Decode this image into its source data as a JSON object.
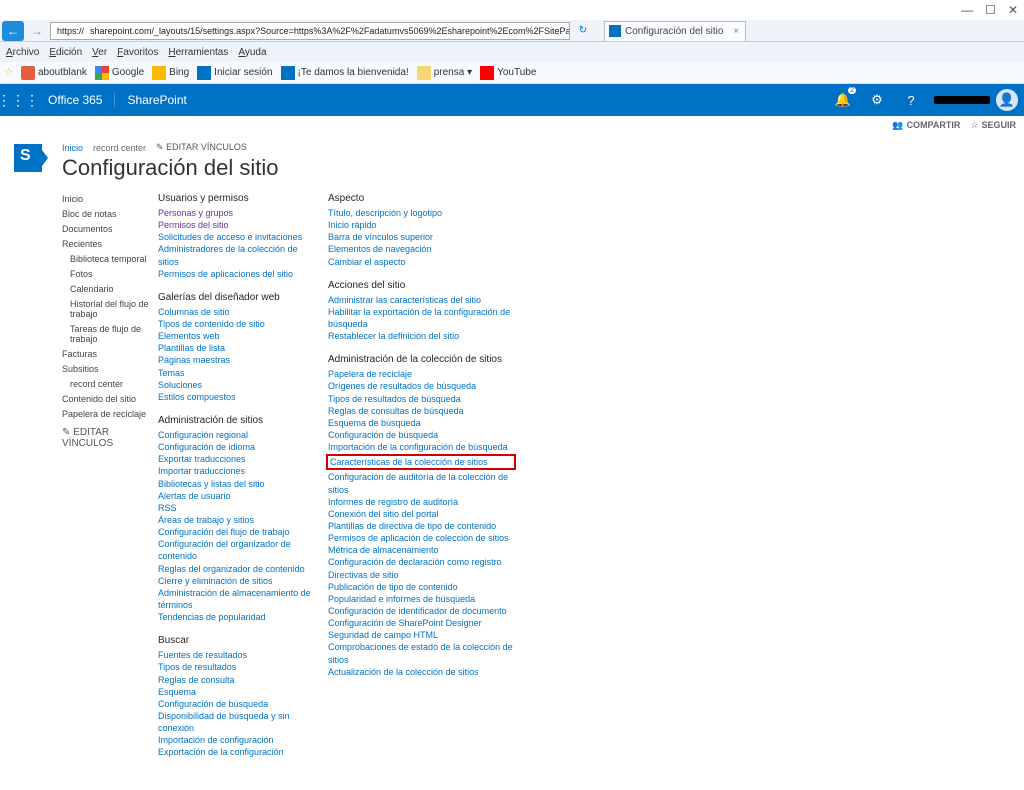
{
  "window": {
    "min": "—",
    "max": "☐",
    "close": "✕"
  },
  "ie": {
    "url_prefix": "https://",
    "url_redacted": true,
    "url_suffix": "sharepoint.com/_layouts/15/settings.aspx?Source=https%3A%2F%2Fadatumvs5069%2Esharepoint%2Ecom%2FSitePages%2…",
    "tab_title": "Configuración del sitio",
    "menu": [
      "Archivo",
      "Edición",
      "Ver",
      "Favoritos",
      "Herramientas",
      "Ayuda"
    ],
    "fav": [
      {
        "icon": "ico-ab",
        "label": "aboutblank"
      },
      {
        "icon": "ico-goog",
        "label": "Google"
      },
      {
        "icon": "ico-bing",
        "label": "Bing"
      },
      {
        "icon": "ico-login",
        "label": "Iniciar sesión"
      },
      {
        "icon": "ico-bienv",
        "label": "¡Te damos la bienvenida!"
      },
      {
        "icon": "ico-folder",
        "label": "prensa ▾"
      },
      {
        "icon": "ico-yt",
        "label": "YouTube"
      }
    ]
  },
  "suite": {
    "o365": "Office 365",
    "sp": "SharePoint",
    "notif": "2"
  },
  "ribbon": {
    "share": "COMPARTIR",
    "follow": "SEGUIR"
  },
  "crumbs": {
    "home": "Inicio",
    "rc": "record center",
    "edit": "EDITAR VÍNCULOS"
  },
  "page_title": "Configuración del sitio",
  "leftnav": {
    "items": [
      {
        "t": "Inicio",
        "k": "hdr"
      },
      {
        "t": "Bloc de notas",
        "k": "hdr"
      },
      {
        "t": "Documentos",
        "k": "hdr"
      },
      {
        "t": "Recientes",
        "k": "hdr"
      },
      {
        "t": "Biblioteca temporal",
        "k": "sub"
      },
      {
        "t": "Fotos",
        "k": "sub"
      },
      {
        "t": "Calendario",
        "k": "sub"
      },
      {
        "t": "Historial del flujo de trabajo",
        "k": "sub"
      },
      {
        "t": "Tareas de flujo de trabajo",
        "k": "sub"
      },
      {
        "t": "Facturas",
        "k": "hdr"
      },
      {
        "t": "Subsitios",
        "k": "hdr"
      },
      {
        "t": "record center",
        "k": "sub"
      },
      {
        "t": "Contenido del sitio",
        "k": "hdr"
      },
      {
        "t": "Papelera de reciclaje",
        "k": "hdr"
      }
    ],
    "edit": "EDITAR VÍNCULOS"
  },
  "c1": {
    "s1_h": "Usuarios y permisos",
    "s1": [
      "Personas y grupos",
      "Permisos del sitio",
      "Solicitudes de acceso e invitaciones",
      "Administradores de la colección de sitios",
      "Permisos de aplicaciones del sitio"
    ],
    "s1_visited": [
      0,
      1
    ],
    "s2_h": "Galerías del diseñador web",
    "s2": [
      "Columnas de sitio",
      "Tipos de contenido de sitio",
      "Elementos web",
      "Plantillas de lista",
      "Páginas maestras",
      "Temas",
      "Soluciones",
      "Estilos compuestos"
    ],
    "s3_h": "Administración de sitios",
    "s3": [
      "Configuración regional",
      "Configuración de idioma",
      "Exportar traducciones",
      "Importar traducciones",
      "Bibliotecas y listas del sitio",
      "Alertas de usuario",
      "RSS",
      "Áreas de trabajo y sitios",
      "Configuración del flujo de trabajo",
      "Configuración del organizador de contenido",
      "Reglas del organizador de contenido",
      "Cierre y eliminación de sitios",
      "Administración de almacenamiento de términos",
      "Tendencias de popularidad"
    ],
    "s4_h": "Buscar",
    "s4": [
      "Fuentes de resultados",
      "Tipos de resultados",
      "Reglas de consulta",
      "Esquema",
      "Configuración de búsqueda",
      "Disponibilidad de búsqueda y sin conexión",
      "Importación de configuración",
      "Exportación de la configuración"
    ]
  },
  "c2": {
    "s1_h": "Aspecto",
    "s1": [
      "Título, descripción y logotipo",
      "Inicio rápido",
      "Barra de vínculos superior",
      "Elementos de navegación",
      "Cambiar el aspecto"
    ],
    "s2_h": "Acciones del sitio",
    "s2": [
      "Administrar las características del sitio",
      "Habilitar la exportación de la configuración de búsqueda",
      "Restablecer la definición del sitio"
    ],
    "s3_h": "Administración de la colección de sitios",
    "s3_top": [
      "Papelera de reciclaje",
      "Orígenes de resultados de búsqueda",
      "Tipos de resultados de búsqueda",
      "Reglas de consultas de búsqueda",
      "Esquema de búsqueda",
      "Configuración de búsqueda",
      "Importación de la configuración de búsqueda"
    ],
    "s3_hl": [
      "Características de la colección de sitios"
    ],
    "s3_bot": [
      "Configuración de auditoría de la colección de sitios",
      "Informes de registro de auditoría",
      "Conexión del sitio del portal",
      "Plantillas de directiva de tipo de contenido",
      "Permisos de aplicación de colección de sitios",
      "Métrica de almacenamiento",
      "Configuración de declaración como registro",
      "Directivas de sitio",
      "Publicación de tipo de contenido",
      "Popularidad e informes de búsqueda",
      "Configuración de identificador de documento",
      "Configuración de SharePoint Designer",
      "Seguridad de campo HTML",
      "Comprobaciones de estado de la colección de sitios",
      "Actualización de la colección de sitios"
    ]
  }
}
